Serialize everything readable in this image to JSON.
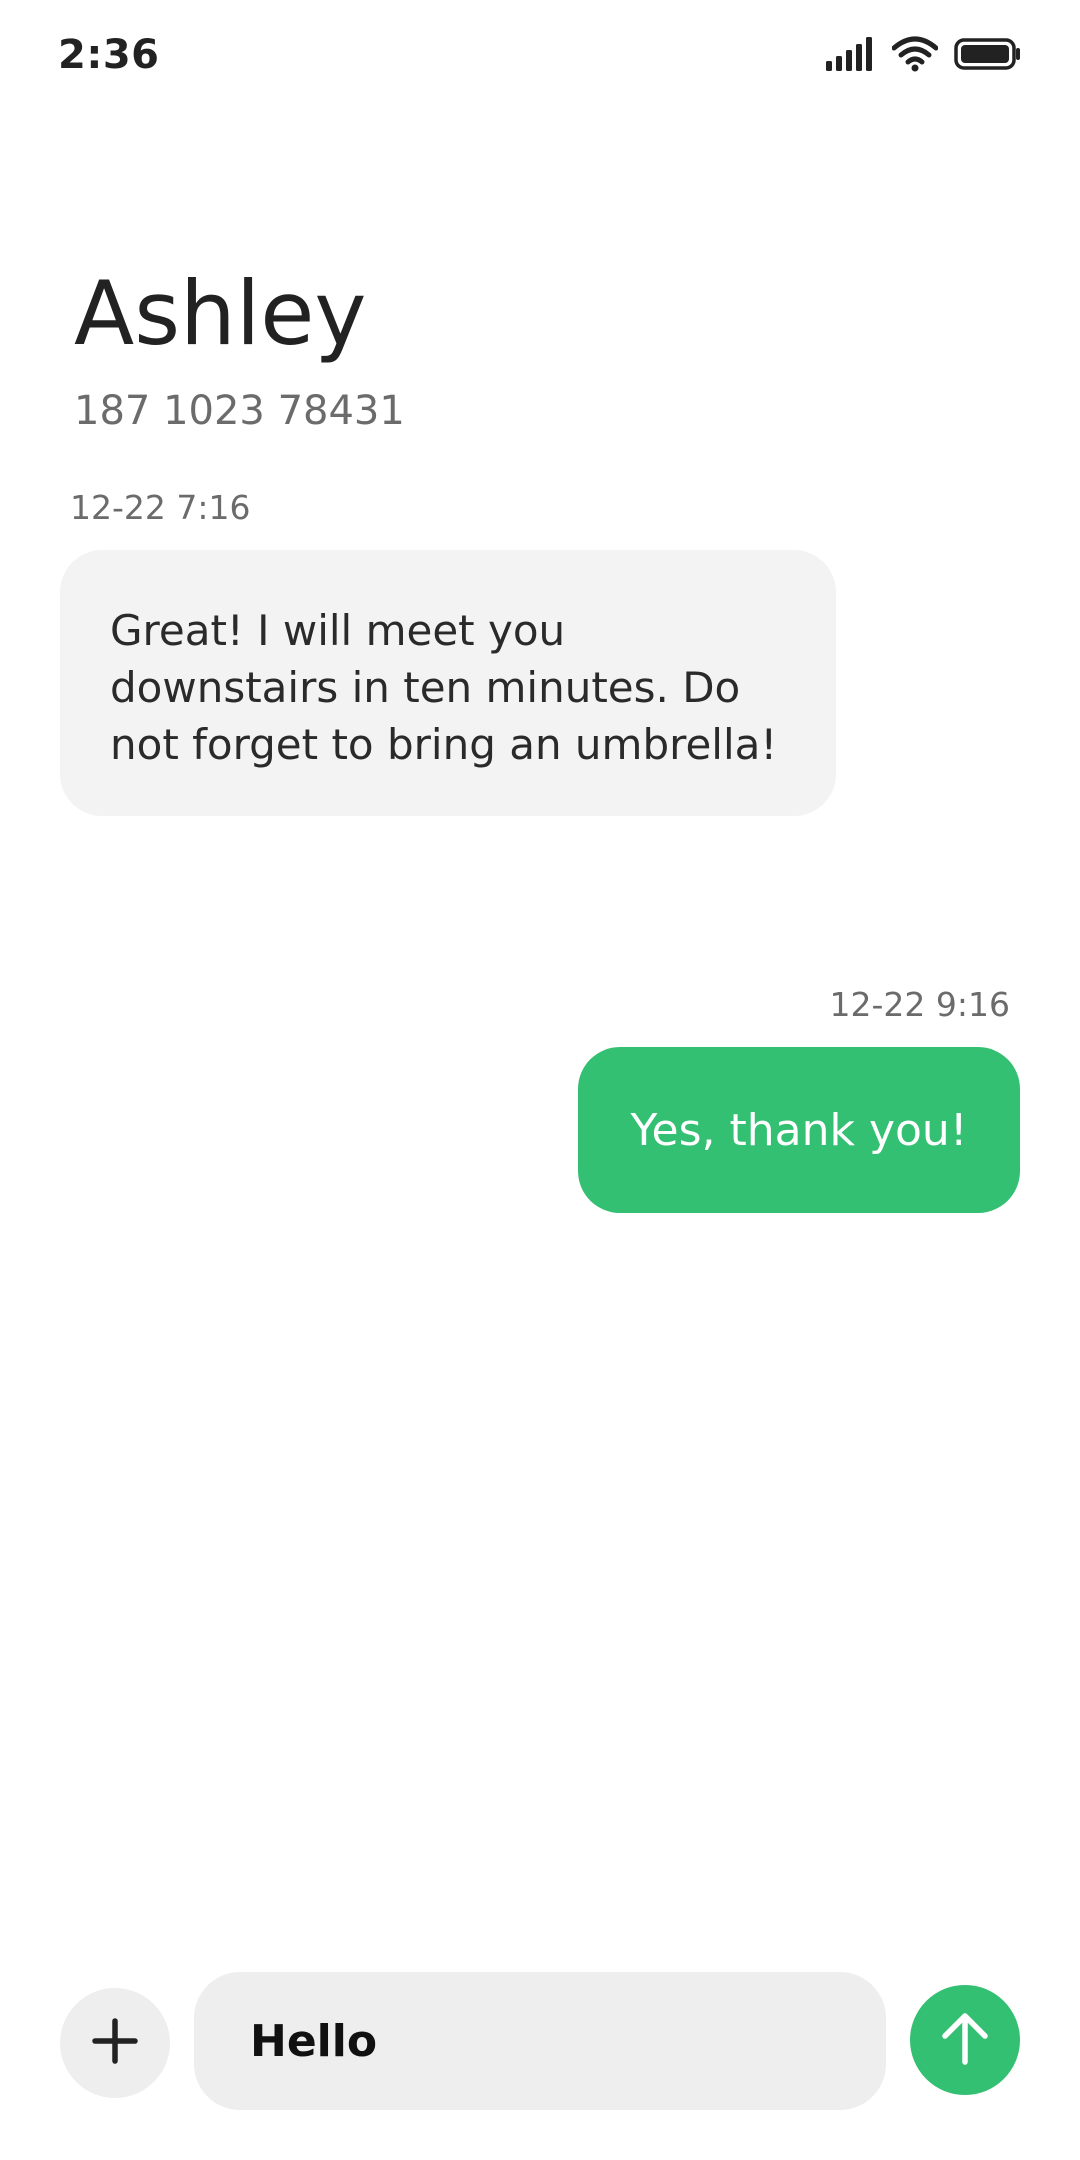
{
  "status_bar": {
    "time": "2:36",
    "icons": [
      "signal-icon",
      "wifi-icon",
      "battery-icon"
    ]
  },
  "contact": {
    "name": "Ashley",
    "number": "187 1023 78431"
  },
  "messages": [
    {
      "direction": "incoming",
      "timestamp": "12-22 7:16",
      "text": "Great! I will meet you downstairs in ten minutes. Do not forget to bring an umbrella!"
    },
    {
      "direction": "outgoing",
      "timestamp": "12-22 9:16",
      "text": "Yes, thank you!"
    }
  ],
  "composer": {
    "add_icon": "plus-icon",
    "input_value": "Hello",
    "send_icon": "arrow-up-icon"
  },
  "colors": {
    "accent": "#33c072",
    "incoming_bubble": "#f3f3f3",
    "input_background": "#eeeeee"
  }
}
